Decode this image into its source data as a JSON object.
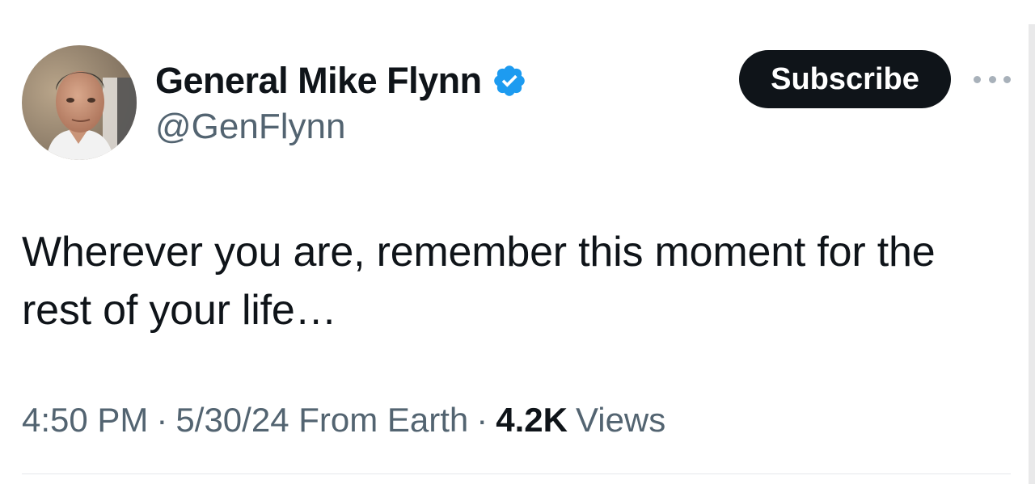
{
  "author": {
    "display_name": "General Mike Flynn",
    "handle": "@GenFlynn",
    "verified": true,
    "avatar_icon": "profile-photo",
    "verified_color": "#1d9bf0"
  },
  "actions": {
    "subscribe_label": "Subscribe",
    "more_icon": "more-horizontal-icon"
  },
  "tweet": {
    "text": "Wherever you are, remember this moment for the rest of your life…"
  },
  "meta": {
    "time": "4:50 PM",
    "separator": "·",
    "date_source": "5/30/24 From Earth",
    "views_count": "4.2K",
    "views_label": "Views"
  },
  "colors": {
    "text_primary": "#0f1419",
    "text_secondary": "#536471",
    "button_bg": "#0f1419",
    "button_text": "#ffffff"
  }
}
